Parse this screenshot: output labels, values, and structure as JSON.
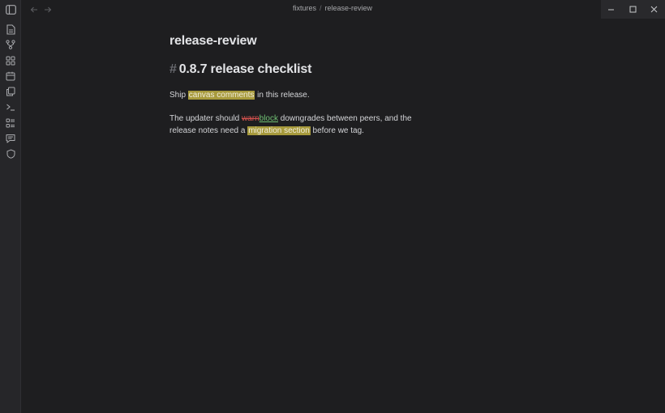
{
  "breadcrumb": {
    "folder": "fixtures",
    "separator": "/",
    "file": "release-review"
  },
  "ribbon": {
    "items": [
      {
        "icon": "sidebar-toggle-icon"
      },
      {
        "icon": "file-icon"
      },
      {
        "icon": "git-branch-icon"
      },
      {
        "icon": "grid-icon"
      },
      {
        "icon": "calendar-icon"
      },
      {
        "icon": "copy-icon"
      },
      {
        "icon": "terminal-icon"
      },
      {
        "icon": "list-icon"
      },
      {
        "icon": "comment-icon"
      },
      {
        "icon": "shield-icon"
      }
    ]
  },
  "document": {
    "title": "release-review",
    "heading_marker": "#",
    "heading": "0.8.7 release checklist",
    "p1": {
      "before": "Ship ",
      "highlight": "canvas comments",
      "after": " in this release."
    },
    "p2": {
      "before": "The updater should ",
      "deleted": "warn",
      "inserted": "block",
      "middle": " downgrades between peers, and the release notes need a ",
      "highlight": "migration section",
      "after": " before we tag."
    }
  },
  "colors": {
    "background": "#1e1e20",
    "highlight": "#a79a3c",
    "deleted": "#d9534f",
    "inserted": "#6fbf73"
  }
}
